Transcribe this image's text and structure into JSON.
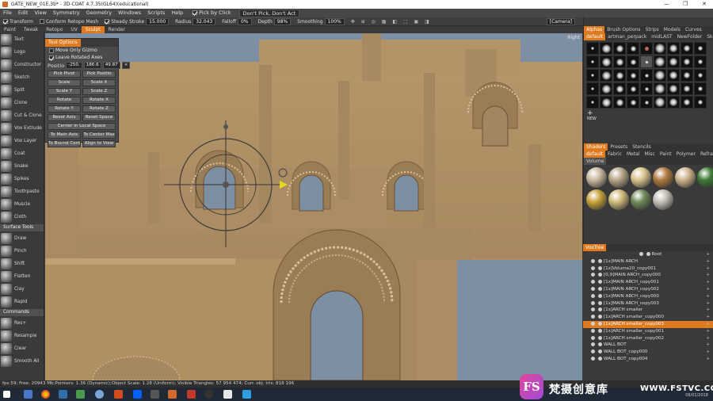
{
  "window": {
    "title": "GATE_NEW_01E.3b* - 3D-COAT 4.7.35(GL64)(educational)",
    "controls": [
      "—",
      "❐",
      "✕"
    ]
  },
  "menu": {
    "items": [
      "File",
      "Edit",
      "View",
      "Symmetry",
      "Geometry",
      "Windows",
      "Scripts",
      "Help"
    ],
    "pick_by_click": "Pick by Click",
    "pick_mode": "Don't Pick, Don't Act"
  },
  "toolbar": {
    "transform": "Transform",
    "conform": "Conform Retopo Mesh",
    "steady_stroke_label": "Steady Stroke",
    "steady_stroke": "15.000",
    "radius_label": "Radius",
    "radius": "32.043",
    "falloff_label": "Falloff",
    "falloff": "0%",
    "depth_label": "Depth",
    "depth": "98%",
    "smoothing_label": "Smoothing",
    "smoothing": "100%",
    "camera": "[Camera]"
  },
  "rooms": [
    "Paint",
    "Tweak",
    "Retopo",
    "UV",
    "Sculpt",
    "Render"
  ],
  "rooms_active": "Sculpt",
  "left_tools": {
    "voxel": [
      "Text",
      "Logo",
      "Constructor",
      "Sketch",
      "Split",
      "Clone",
      "Cut & Clone",
      "Vox Extrude",
      "Vox Layer",
      "Coat",
      "Snake",
      "Spikes",
      "Toothpaste",
      "Muscle",
      "Cloth"
    ],
    "surface_header": "Surface Tools",
    "surface": [
      "Draw",
      "Pinch",
      "Shift",
      "Flatten",
      "Clay",
      "Rapid"
    ],
    "commands_header": "Commands",
    "commands": [
      "Res+",
      "Resample",
      "Clear",
      "Smooth All"
    ]
  },
  "tool_options": {
    "title": "Tool Options",
    "move_only_gizmo": "Move Only Gizmo",
    "leave_rotated_axes": "Leave Rotated Axes",
    "position_label": "Positio",
    "pos_x": "-250.",
    "pos_y": "186.6",
    "pos_z": "49.87",
    "pick_pivot": "Pick Pivot",
    "pick_position": "Pick Positio",
    "buttons": [
      [
        "Scale",
        "Scale X"
      ],
      [
        "Scale Y",
        "Scale Z"
      ],
      [
        "Rotate",
        "Rotate X"
      ],
      [
        "Rotate Y",
        "Rotate Z"
      ],
      [
        "Reset Axis",
        "Reset Space"
      ],
      [
        "Center in Local Space",
        ""
      ],
      [
        "To Main Axis",
        "To Center Mas"
      ],
      [
        "To Bound Cent",
        "Align to View"
      ]
    ]
  },
  "viewport": {
    "corner_label": "Right"
  },
  "right_panel": {
    "tabs_top": [
      "Alphas",
      "Brush Options",
      "Strips",
      "Models",
      "Curves"
    ],
    "tabs_top_active": "Alphas",
    "alpha_sets": [
      "default",
      "artman_perpack",
      "midLAST",
      "NewFolder",
      "Skin"
    ],
    "alpha_sets_active": "default",
    "new_label": "NEW",
    "shader_tabs": [
      "Shaders",
      "Presets",
      "Stencils"
    ],
    "shader_tabs_active": "Shaders",
    "shader_sets": [
      "default",
      "Fabric",
      "Metal",
      "Misc",
      "Paint",
      "Polymer",
      "Refractive"
    ],
    "shader_sets_active": "default",
    "shader_sub": "Volume",
    "shader_colors": [
      "#c9b9a0",
      "#b8a688",
      "#d8c490",
      "#b07a42",
      "#cfb48c",
      "#3f7a36",
      "#c7a13a",
      "#cdbb7a",
      "#6f8a5a",
      "#c2c0b4"
    ]
  },
  "vox_tree": {
    "title": "VoxTree",
    "rows": [
      {
        "label": "Root",
        "selected": false
      },
      {
        "label": "[1x]MAIN  ARCH",
        "selected": false
      },
      {
        "label": "[1x]Volume20_copy001",
        "selected": false
      },
      {
        "label": "[0,9]MAIN  ARCH_copy000",
        "selected": false
      },
      {
        "label": "[1x]MAIN  ARCH_copy001",
        "selected": false
      },
      {
        "label": "[1x]MAIN  ARCH_copy002",
        "selected": false
      },
      {
        "label": "[1x]MAIN  ARCH_copy000",
        "selected": false
      },
      {
        "label": "[1x]MAIN  ARCH_copy003",
        "selected": false
      },
      {
        "label": "[1x]ARCH  smaller",
        "selected": false
      },
      {
        "label": "[1x]ARCH  smaller_copy000",
        "selected": false
      },
      {
        "label": "[1x]ARCH  smaller_copy003",
        "selected": true
      },
      {
        "label": "[1x]ARCH  smaller_copy001",
        "selected": false
      },
      {
        "label": "[1x]ARCH  smaller_copy002",
        "selected": false
      },
      {
        "label": "WALL  BOT",
        "selected": false
      },
      {
        "label": "WALL  BOT_copy000",
        "selected": false
      },
      {
        "label": "WALL  BOT_copy004",
        "selected": false
      }
    ]
  },
  "status": {
    "text": "fps:59;   Free: 20943 Mb;Pointers: 1.36 (Dynamic);Object Scale: 1.28 (Uniform);  Visible Triangles: 57 954 474;  Curr. obj. tris: 818 196"
  },
  "watermark": {
    "logo": "FS",
    "cn": "梵摄创意库",
    "url": "WWW.FSTVC.CC"
  },
  "clock": "06/01/2018"
}
